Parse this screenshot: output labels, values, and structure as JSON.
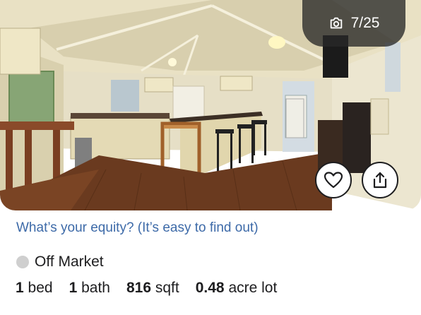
{
  "photo": {
    "counter": "7/25",
    "camera_icon": "camera-icon",
    "alt": "Interior kitchen and dining room photo"
  },
  "actions": {
    "favorite_icon": "heart-icon",
    "share_icon": "share-icon"
  },
  "equity_link": "What’s your equity? (It’s easy to find out)",
  "status": {
    "label": "Off Market",
    "dot_color": "#cfcfcf"
  },
  "facts": {
    "beds_value": "1",
    "beds_label": "bed",
    "baths_value": "1",
    "baths_label": "bath",
    "sqft_value": "816",
    "sqft_label": "sqft",
    "lot_value": "0.48",
    "lot_label": "acre lot"
  },
  "colors": {
    "link": "#3d6aa8",
    "text": "#1d1d1f"
  }
}
